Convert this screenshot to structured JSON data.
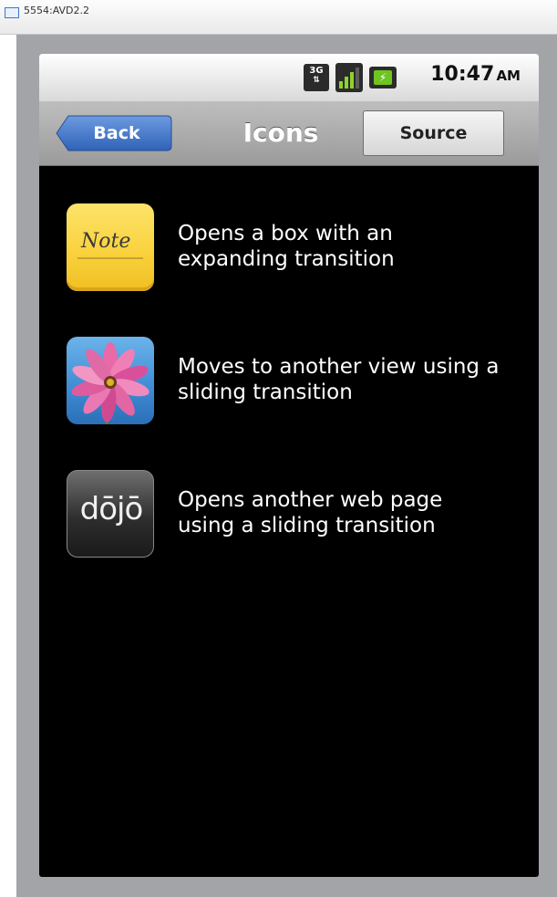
{
  "window": {
    "title": "5554:AVD2.2"
  },
  "status_bar": {
    "network": "3G",
    "time": "10:47",
    "ampm": "AM",
    "battery_glyph": "⚡"
  },
  "header": {
    "back_label": "Back",
    "title": "Icons",
    "source_label": "Source"
  },
  "items": [
    {
      "icon": "note-icon",
      "icon_text": "Note",
      "text": "Opens a box with an\nexpanding transition"
    },
    {
      "icon": "flower-photo-icon",
      "text": "Moves to another view using a\nsliding transition"
    },
    {
      "icon": "dojo-icon",
      "icon_text": "dōjō",
      "text": "Opens another web page\nusing a sliding transition"
    }
  ],
  "colors": {
    "header_bg": "#a9a9a9",
    "back_button": "#3f74c9",
    "screen_bg": "#000000",
    "frame": "#a2a4a8"
  }
}
